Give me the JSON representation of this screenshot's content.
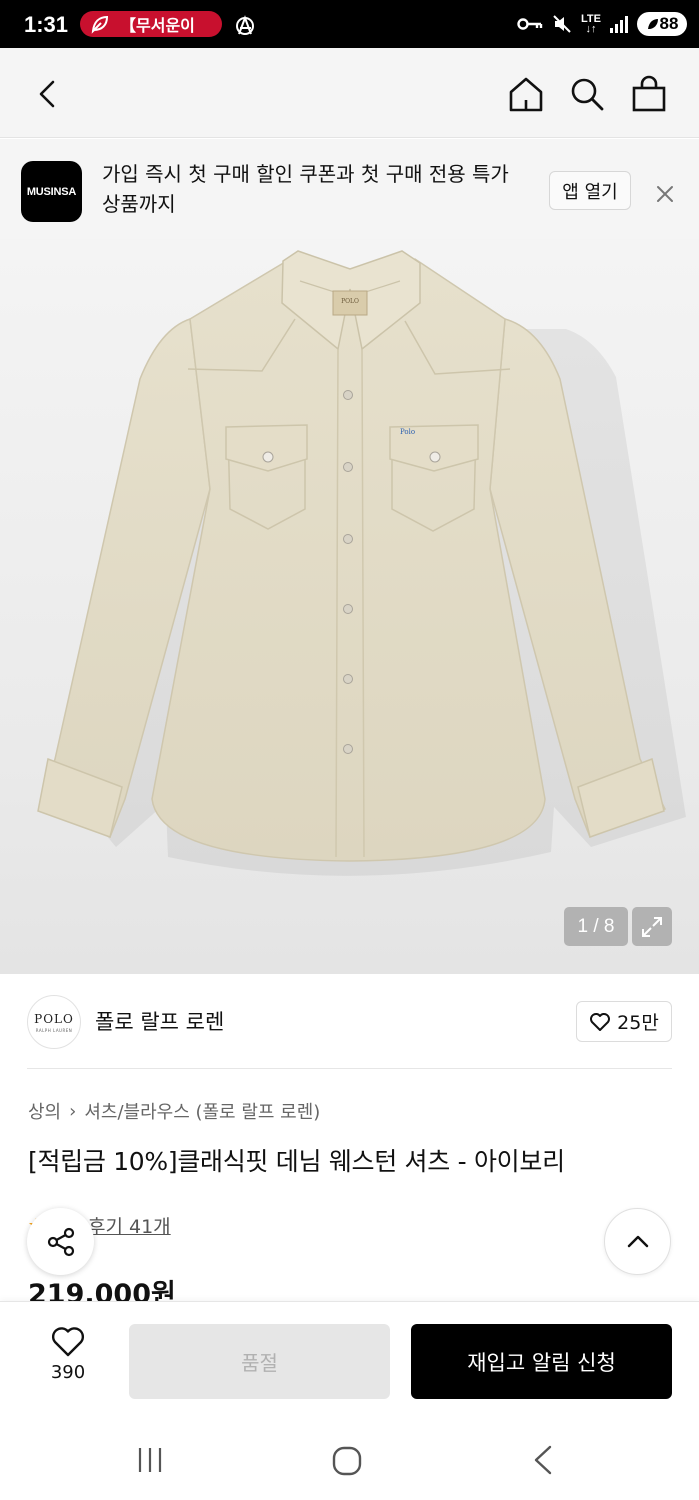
{
  "status_bar": {
    "time": "1:31",
    "notification": "【무서운이",
    "lte_top": "LTE",
    "lte_bottom": "↓↑",
    "battery": "88"
  },
  "banner": {
    "logo_text": "MUSINSA",
    "text": "가입 즉시 첫 구매 할인 쿠폰과 첫 구매 전용 특가 상품까지",
    "open_app_label": "앱 열기"
  },
  "gallery": {
    "counter": "1 / 8",
    "shirt_label_text": "POLO",
    "shirt_logo_text": "Polo"
  },
  "brand": {
    "logo_text": "POLO",
    "logo_subtext": "RALPH LAUREN",
    "name": "폴로 랄프 로렌",
    "likes": "25만"
  },
  "breadcrumb": {
    "category": "상의",
    "separator": "›",
    "subcategory": "셔츠/블라우스 (폴로 랄프 로렌)"
  },
  "product": {
    "title": "[적립금 10%]클래식핏 데님 웨스턴 셔츠 - 아이보리",
    "review_label": "후기 41개",
    "price": "219,000원"
  },
  "actions": {
    "wish_count": "390",
    "soldout_label": "품절",
    "restock_label": "재입고 알림 신청"
  },
  "colors": {
    "accent": "#000000",
    "notification_pill": "#c8102e",
    "star": "#f5a623",
    "disabled": "#e6e6e6"
  }
}
